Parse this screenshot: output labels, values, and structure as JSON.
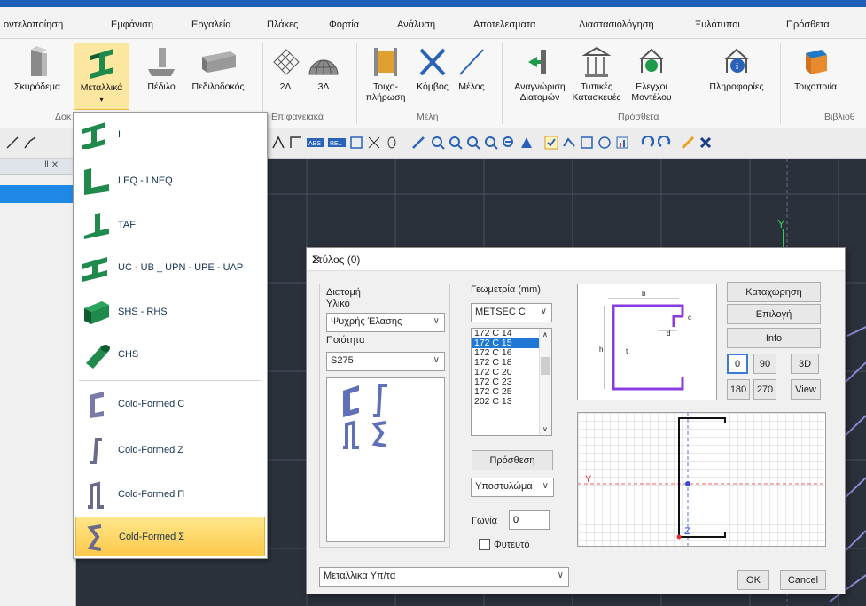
{
  "ribbon_tabs": [
    "οντελοποίηση",
    "Εμφάνιση",
    "Εργαλεία",
    "Πλάκες",
    "Φορτία",
    "Ανάλυση",
    "Αποτελεσματα",
    "Διαστασιολόγηση",
    "Ξυλότυποι",
    "Πρόσθετα"
  ],
  "ribbon": {
    "btn_concrete": "Σκυρόδεμα",
    "btn_steel": "Μεταλλικά",
    "btn_pedilo": "Πέδιλο",
    "btn_pedilodokos": "Πεδιλοδοκός",
    "btn_2d": "2Δ",
    "btn_3d": "3Δ",
    "btn_wall_1": "Τοιχο-",
    "btn_wall_2": "πλήρωση",
    "btn_node": "Κόμβος",
    "btn_member": "Μέλος",
    "btn_recog_1": "Αναγνώριση",
    "btn_recog_2": "Διατομών",
    "btn_typical_1": "Τυπικές",
    "btn_typical_2": "Κατασκευές",
    "btn_checks_1": "Ελεγχοι",
    "btn_checks_2": "Μοντέλου",
    "btn_info": "Πληροφορίες",
    "btn_masonry": "Τοιχοποιία",
    "grp_dok": "Δοκ",
    "grp_surfaces": "Επιφανειακά",
    "grp_members": "Μέλη",
    "grp_extra": "Πρόσθετα",
    "grp_lib": "Βιβλιοθ"
  },
  "panel_pin": "Ⅱ ✕",
  "axis_y": "Y",
  "menu_items": [
    "I",
    "LEQ - LNEQ",
    "TAF",
    "UC - UB _ UPN - UPE - UAP",
    "SHS - RHS",
    "CHS",
    "Cold-Formed C",
    "Cold-Formed Z",
    "Cold-Formed Π",
    "Cold-Formed Σ"
  ],
  "dialog": {
    "title": "Στύλος (0)",
    "close": "✕",
    "section_label": "Διατομή",
    "material_label": "Υλικό",
    "material_value": "Ψυχρής Έλασης",
    "quality_label": "Ποιότητα",
    "quality_value": "S275",
    "geometry_label": "Γεωμετρία (mm)",
    "geometry_value": "METSEC C",
    "profiles": [
      "172 C 14",
      "172 C 15",
      "172 C 16",
      "172 C 18",
      "172 C 20",
      "172 C 23",
      "172 C 25",
      "202 C 13"
    ],
    "add_button": "Πρόσθεση",
    "type_value": "Υποστυλώμα",
    "angle_label": "Γωνία",
    "angle_value": "0",
    "planted_label": "Φυτευτό",
    "register_button": "Καταχώρηση",
    "select_button": "Επιλογή",
    "info_button": "Info",
    "rot_buttons": [
      "0",
      "90",
      "180",
      "270"
    ],
    "btn_3d": "3D",
    "btn_view": "View",
    "dim_b": "b",
    "dim_c": "c",
    "dim_d": "d",
    "dim_h": "h",
    "dim_t": "t",
    "axis_y": "Y",
    "axis_z": "Z",
    "family_value": "Μεταλλικα Υπ/τα",
    "ok": "OK",
    "cancel": "Cancel"
  }
}
